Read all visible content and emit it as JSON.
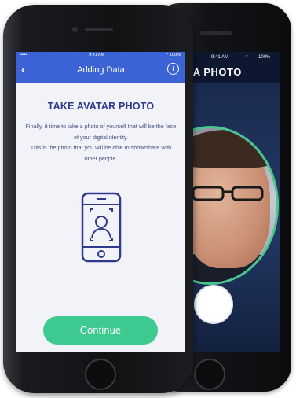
{
  "back_phone": {
    "status": {
      "time": "9:41 AM",
      "bluetooth": "*",
      "battery": "100%"
    },
    "title": "E A PHOTO"
  },
  "front_phone": {
    "status": {
      "signal": "••••• ",
      "time": "9:41 AM",
      "battery": "* 100%"
    },
    "nav": {
      "back_icon": "‹",
      "title": "Adding Data",
      "info_icon": "i"
    },
    "heading": "TAKE AVATAR PHOTO",
    "description_1": "Finally, it time to take a photo of yourself that will be the face of your digital identity.",
    "description_2": "This is the photo that you will be able to show/share with other people.",
    "continue_label": "Continue"
  },
  "colors": {
    "accent_blue": "#3c63d6",
    "heading": "#2f3a8e",
    "button_green": "#3dc98f",
    "face_ring": "#46c890"
  }
}
